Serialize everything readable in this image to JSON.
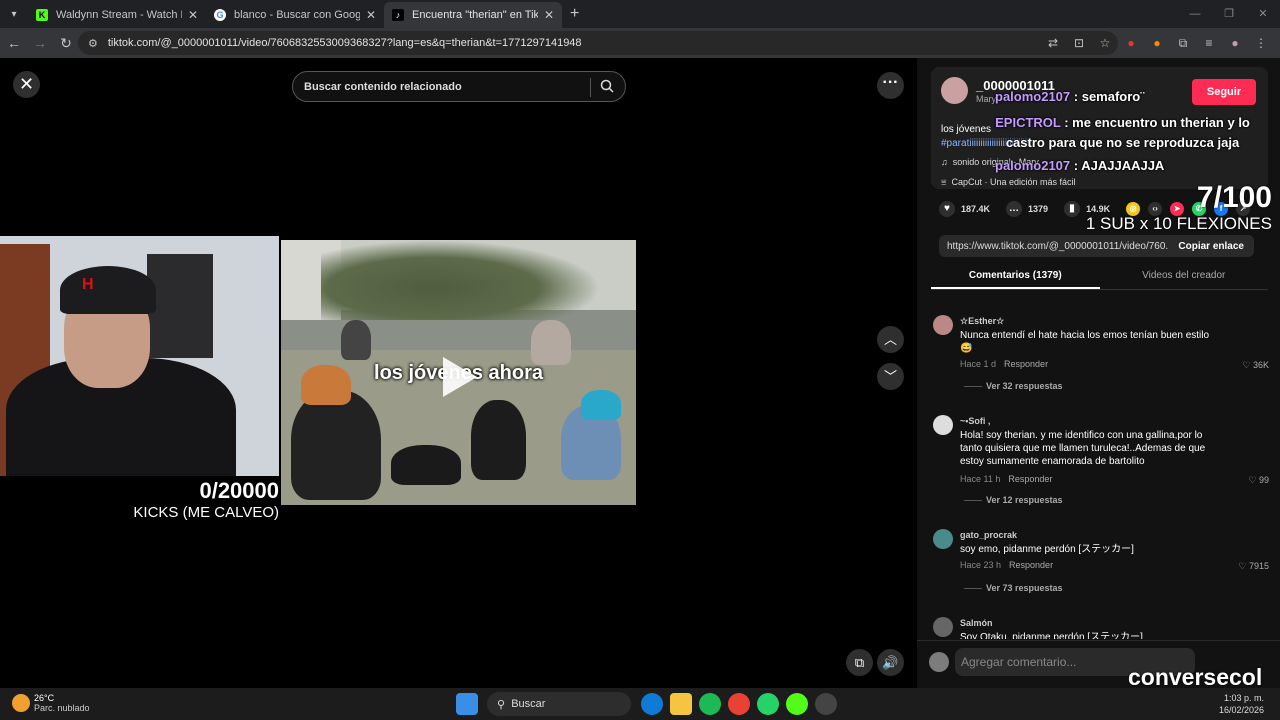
{
  "browser": {
    "tabs": [
      {
        "title": "Waldynn Stream - Watch Live o",
        "favicon": "kick-icon",
        "active": false
      },
      {
        "title": "blanco - Buscar con Google",
        "favicon": "google-icon",
        "active": false
      },
      {
        "title": "Encuentra \"therian\" en TikTok | T",
        "favicon": "tiktok-icon",
        "active": true
      }
    ],
    "url": "tiktok.com/@_0000001011/video/7606832553009368327?lang=es&q=therian&t=1771297141948"
  },
  "video": {
    "search_placeholder": "Buscar contenido relacionado",
    "caption": "los jóvenes ahora"
  },
  "stream_overlay": {
    "kicks_count": "0/20000",
    "kicks_label": "KICKS (ME CALVEO)",
    "goal_count": "7/100",
    "goal_label": "1 SUB x 10 FLEXIONES",
    "chat": [
      {
        "user": "palomo2107",
        "text": " : semaforo¨"
      },
      {
        "user": "EPICTROL",
        "text": " : me encuentro un therian y lo castro para que no se reproduzca jaja"
      },
      {
        "user": "palomo2107",
        "text": " : AJAJJAAJJA"
      }
    ],
    "brand": "conversecol"
  },
  "post": {
    "author": "_0000001011",
    "author_sub": "Mary",
    "follow_label": "Seguir",
    "description": "los jóvenes",
    "hashtag": "#paratiiiiiiiiiiiiiiiiiiiiiiiiiiii",
    "sound": "sonido original - Mary",
    "capcut": "CapCut · Una edición más fácil",
    "likes": "187.4K",
    "comments": "1379",
    "saves": "14.9K",
    "link": "https://www.tiktok.com/@_0000001011/video/760...",
    "copy_label": "Copiar enlace",
    "tab_comments": "Comentarios (1379)",
    "tab_creator": "Videos del creador"
  },
  "comments": [
    {
      "user": "☆Esther☆",
      "text": "Nunca entendí el hate hacia los emos tenían buen estilo 😅",
      "time": "Hace 1 d",
      "reply": "Responder",
      "likes": "36K",
      "replies": "Ver 32 respuestas"
    },
    {
      "user": "~•Sofi ,",
      "text": "Hola! soy therian. y me identifico con una gallina,por lo tanto quisiera que me llamen turuleca!..Ademas de que estoy sumamente enamorada de bartolito",
      "time": "Hace 11 h",
      "reply": "Responder",
      "likes": "99",
      "replies": "Ver 12 respuestas"
    },
    {
      "user": "gato_procrak",
      "text": "soy emo, pidanme perdón [ステッカー]",
      "time": "Hace 23 h",
      "reply": "Responder",
      "likes": "7915",
      "replies": "Ver 73 respuestas"
    },
    {
      "user": "Salmón",
      "text": "Soy Otaku, pidanme perdón [ステッカー]",
      "time": "",
      "reply": "",
      "likes": "",
      "replies": ""
    }
  ],
  "comment_placeholder": "Agregar comentario...",
  "taskbar": {
    "temp": "26°C",
    "weather": "Parc. nublado",
    "search": "Buscar",
    "time": "1:03 p. m.",
    "date": "16/02/2026"
  }
}
